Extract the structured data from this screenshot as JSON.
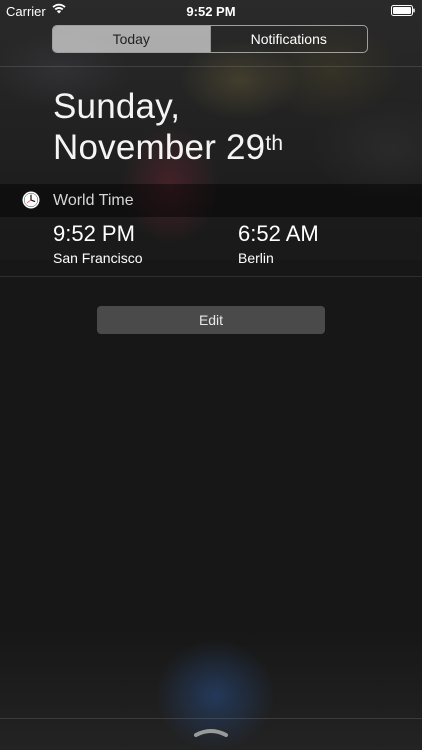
{
  "status_bar": {
    "carrier": "Carrier",
    "time": "9:52 PM",
    "icons": [
      "wifi-icon",
      "battery-icon"
    ]
  },
  "tabs": [
    {
      "label": "Today",
      "selected": true
    },
    {
      "label": "Notifications",
      "selected": false
    }
  ],
  "date": {
    "line1": "Sunday,",
    "line2": "November 29",
    "suffix": "th"
  },
  "widget": {
    "title": "World Time",
    "icon": "clock-icon",
    "clocks": [
      {
        "time": "9:52 PM",
        "city": "San Francisco"
      },
      {
        "time": "6:52 AM",
        "city": "Berlin"
      }
    ]
  },
  "edit_button": {
    "label": "Edit"
  },
  "colors": {
    "background": "#171717",
    "segment_active": "#a7a7a7",
    "edit_button": "#4a4a4a"
  }
}
